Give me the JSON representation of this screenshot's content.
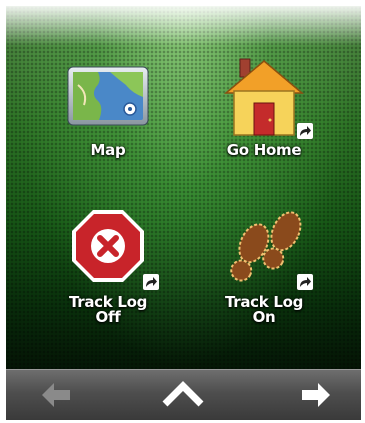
{
  "apps": [
    {
      "label_lines": [
        "Map"
      ],
      "icon": "map-icon",
      "shortcut": false
    },
    {
      "label_lines": [
        "Go Home"
      ],
      "icon": "house-icon",
      "shortcut": true
    },
    {
      "label_lines": [
        "Track Log",
        "Off"
      ],
      "icon": "stop-x-icon",
      "shortcut": true
    },
    {
      "label_lines": [
        "Track Log",
        "On"
      ],
      "icon": "footprints-icon",
      "shortcut": true
    }
  ],
  "navbar": {
    "back": {
      "icon": "arrow-left-icon",
      "enabled": false
    },
    "up": {
      "icon": "chevron-up-icon",
      "enabled": true
    },
    "next": {
      "icon": "arrow-right-icon",
      "enabled": true
    }
  },
  "colors": {
    "screen_top": "#7ccf69",
    "screen_bottom": "#061f08",
    "navbar": "#4e4e4e",
    "disabled_arrow": "#8a8a8a",
    "active_arrow": "#ffffff"
  }
}
